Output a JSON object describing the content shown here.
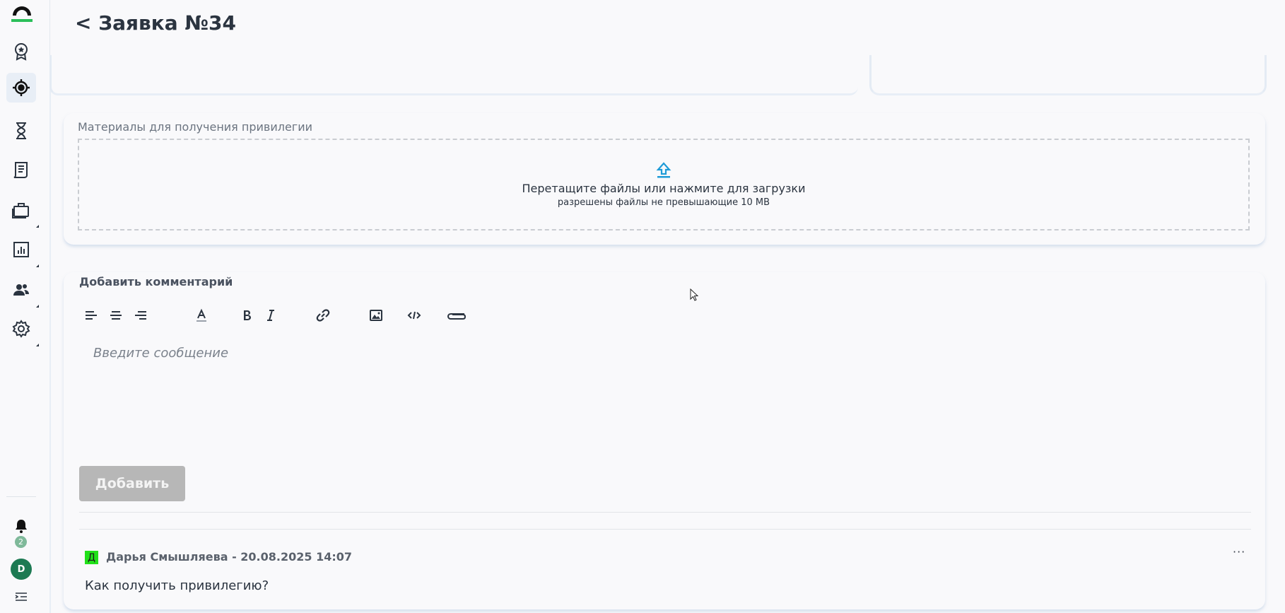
{
  "header": {
    "title": "< Заявка №34"
  },
  "sidebar": {
    "items": [
      {
        "name": "award",
        "icon": "award-icon",
        "active": false
      },
      {
        "name": "target",
        "icon": "target-icon",
        "active": true
      },
      {
        "name": "history",
        "icon": "hourglass-icon",
        "active": false
      },
      {
        "name": "documents",
        "icon": "document-icon",
        "active": false
      },
      {
        "name": "portfolio",
        "icon": "briefcase-icon",
        "active": false
      },
      {
        "name": "reports",
        "icon": "chart-icon",
        "active": false
      },
      {
        "name": "users",
        "icon": "users-icon",
        "active": false
      },
      {
        "name": "settings",
        "icon": "gear-icon",
        "active": false
      }
    ],
    "notifications_count": "2",
    "avatar_initial": "D"
  },
  "materials": {
    "label": "Материалы для получения привилегии",
    "dropzone_title": "Перетащите файлы или нажмите для загрузки",
    "dropzone_hint": "разрешены файлы не превышающие 10 MB"
  },
  "comments": {
    "title": "Добавить комментарий",
    "toolbar": [
      "align-left-icon",
      "align-center-icon",
      "align-right-icon",
      "text-color-icon",
      "bold-icon",
      "italic-icon",
      "link-icon",
      "image-icon",
      "code-icon",
      "attach-icon"
    ],
    "placeholder": "Введите сообщение",
    "add_label": "Добавить",
    "list": [
      {
        "initial": "Д",
        "author_line": "Дарья Смышляева - 20.08.2025 14:07",
        "text": "Как получить привилегию?",
        "more": "···"
      }
    ]
  },
  "colors": {
    "accent_upload": "#1e9bd7",
    "avatar_bg": "#1d7a53",
    "comment_avatar_bg": "#22e01a",
    "notification_badge": "#7fb99a",
    "active_nav_bg": "#e8eef6"
  }
}
